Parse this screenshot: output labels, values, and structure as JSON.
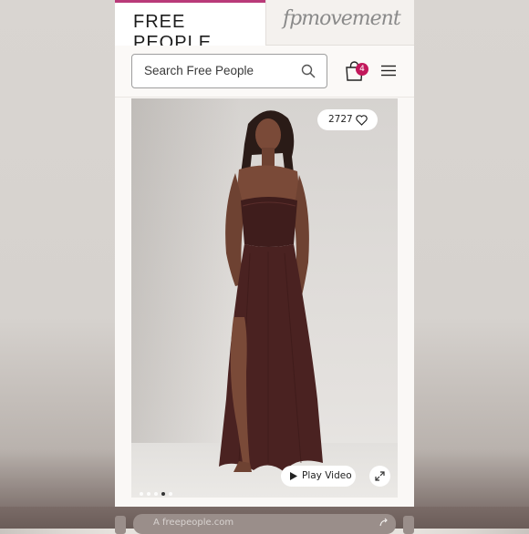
{
  "header": {
    "free_people_tab": "FREE PEOPLE",
    "fp_movement_tab": "fpmovement"
  },
  "search": {
    "placeholder": "Search Free People"
  },
  "cart": {
    "count": "4"
  },
  "product": {
    "like_count": "2727",
    "play_video_label": "Play Video",
    "carousel": {
      "total": 5,
      "active_index": 3
    }
  },
  "browser": {
    "url_text": "A  freepeople.com"
  },
  "icons": {
    "search": "search-icon",
    "bag": "shopping-bag-icon",
    "menu": "hamburger-menu-icon",
    "heart": "heart-icon",
    "play": "play-icon",
    "expand": "expand-icon",
    "share": "share-icon"
  },
  "colors": {
    "accent": "#b93a79",
    "badge": "#c2185b",
    "dress": "#4a2221"
  }
}
